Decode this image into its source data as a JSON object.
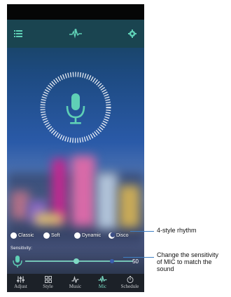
{
  "modes": {
    "classic": "Classic",
    "soft": "Soft",
    "dynamic": "Dynamic",
    "disco": "Disco"
  },
  "sensitivity": {
    "label": "Sensitivity:",
    "value": "50"
  },
  "tabs": [
    {
      "label": "Adjust",
      "icon": "sliders-icon"
    },
    {
      "label": "Style",
      "icon": "grid-icon"
    },
    {
      "label": "Music",
      "icon": "music-note-icon"
    },
    {
      "label": "Mic",
      "icon": "mic-wave-icon"
    },
    {
      "label": "Schedule",
      "icon": "timer-icon"
    }
  ],
  "active_tab": "Mic",
  "annotations": {
    "rhythm": "4-style rhythm",
    "sensitivity_lines": [
      "Change the sensitivity",
      "of MIC to match the",
      "sound"
    ]
  },
  "colors": {
    "accent": "#5fd0b6",
    "slider_track": "#7fd9c4",
    "callout": "#3e7fc4"
  }
}
